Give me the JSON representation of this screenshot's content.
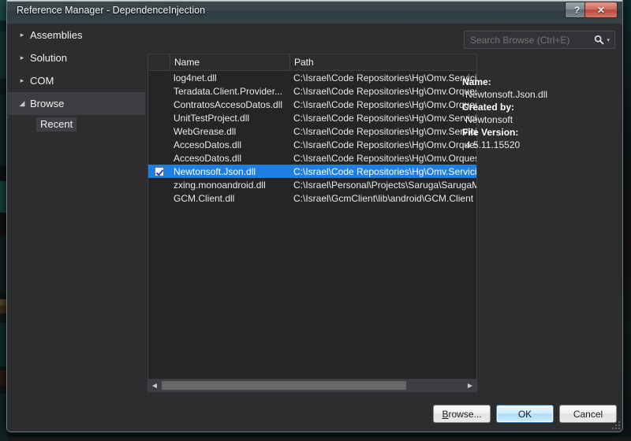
{
  "window": {
    "title": "Reference Manager - DependenceInjection",
    "help_button": "?",
    "close_button": "✕"
  },
  "sidebar": {
    "items": [
      {
        "label": "Assemblies",
        "expander": "▸",
        "selected": false
      },
      {
        "label": "Solution",
        "expander": "▸",
        "selected": false
      },
      {
        "label": "COM",
        "expander": "▸",
        "selected": false
      },
      {
        "label": "Browse",
        "expander": "◢",
        "selected": true
      }
    ],
    "child": {
      "label": "Recent",
      "selected": true
    }
  },
  "search": {
    "placeholder": "Search Browse (Ctrl+E)",
    "value": "",
    "icon": "search-icon",
    "caret": "▾"
  },
  "list": {
    "columns": [
      "",
      "Name",
      "Path"
    ],
    "rows": [
      {
        "checked": false,
        "name": "log4net.dll",
        "path": "C:\\Israel\\Code Repositories\\Hg\\Omv.Servicio",
        "selected": false
      },
      {
        "checked": false,
        "name": "Teradata.Client.Provider...",
        "path": "C:\\Israel\\Code Repositories\\Hg\\Omv.Orques",
        "selected": false
      },
      {
        "checked": false,
        "name": "ContratosAccesoDatos.dll",
        "path": "C:\\Israel\\Code Repositories\\Hg\\Omv.Orques",
        "selected": false
      },
      {
        "checked": false,
        "name": "UnitTestProject.dll",
        "path": "C:\\Israel\\Code Repositories\\Hg\\Omv.Servicio",
        "selected": false
      },
      {
        "checked": false,
        "name": "WebGrease.dll",
        "path": "C:\\Israel\\Code Repositories\\Hg\\Omv.Servicio",
        "selected": false
      },
      {
        "checked": false,
        "name": "AccesoDatos.dll",
        "path": "C:\\Israel\\Code Repositories\\Hg\\Omv.Orques",
        "selected": false
      },
      {
        "checked": false,
        "name": "AccesoDatos.dll",
        "path": "C:\\Israel\\Code Repositories\\Hg\\Omv.Orques",
        "selected": false
      },
      {
        "checked": true,
        "name": "Newtonsoft.Json.dll",
        "path": "C:\\Israel\\Code Repositories\\Hg\\Omv.Servicio",
        "selected": true
      },
      {
        "checked": false,
        "name": "zxing.monoandroid.dll",
        "path": "C:\\Israel\\Personal\\Projects\\Saruga\\SarugaM",
        "selected": false
      },
      {
        "checked": false,
        "name": "GCM.Client.dll",
        "path": "C:\\Israel\\GcmClient\\lib\\android\\GCM.Client",
        "selected": false
      }
    ],
    "scrollbar": {
      "left_arrow": "◀",
      "right_arrow": "▶"
    }
  },
  "details": [
    {
      "key": "Name:",
      "value": "Newtonsoft.Json.dll"
    },
    {
      "key": "Created by:",
      "value": "Newtonsoft"
    },
    {
      "key": "File Version:",
      "value": "4.5.11.15520"
    }
  ],
  "buttons": {
    "browse_mnemonic": "B",
    "browse_rest": "rowse...",
    "ok": "OK",
    "cancel": "Cancel"
  },
  "colors": {
    "selection_blue": "#1f7fe0",
    "panel_bg": "#252526",
    "dialog_bg": "#2d2d30",
    "close_red": "#b4493a"
  }
}
